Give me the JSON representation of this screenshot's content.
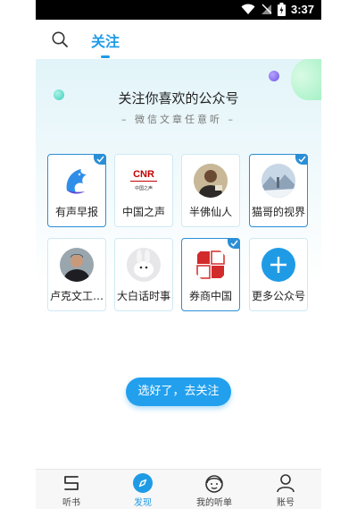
{
  "status_bar": {
    "time": "3:37",
    "icons": [
      "wifi-icon",
      "signal-off-icon",
      "battery-icon"
    ]
  },
  "top_bar": {
    "tab_label": "关注",
    "icons": [
      "search-icon"
    ]
  },
  "intro": {
    "title": "关注你喜欢的公众号",
    "subtitle": "– 微信文章任意听 –"
  },
  "accounts": [
    {
      "label": "有声早报",
      "selected": true,
      "icon": "dolphin-logo"
    },
    {
      "label": "中国之声",
      "selected": false,
      "icon": "cnr-logo"
    },
    {
      "label": "半佛仙人",
      "selected": false,
      "icon": "portrait-avatar"
    },
    {
      "label": "猫哥的视界",
      "selected": true,
      "icon": "snow-scene-avatar"
    },
    {
      "label": "卢克文工…",
      "selected": false,
      "icon": "portrait-avatar"
    },
    {
      "label": "大白话时事",
      "selected": false,
      "icon": "rabbit-avatar"
    },
    {
      "label": "券商中国",
      "selected": true,
      "icon": "seal-logo"
    },
    {
      "label": "更多公众号",
      "selected": false,
      "icon": "plus-icon"
    }
  ],
  "cnr_logo": {
    "text": "CNR",
    "subtext": "中国之声"
  },
  "confirm_button": {
    "label": "选好了，去关注"
  },
  "bottom_nav": [
    {
      "label": "听书",
      "icon": "book-icon",
      "active": false
    },
    {
      "label": "发现",
      "icon": "compass-icon",
      "active": true
    },
    {
      "label": "我的听单",
      "icon": "headphones-face-icon",
      "active": false
    },
    {
      "label": "账号",
      "icon": "user-icon",
      "active": false
    }
  ],
  "colors": {
    "accent": "#1f9be6",
    "check": "#2a8fd6",
    "button": "#22a0ee"
  }
}
